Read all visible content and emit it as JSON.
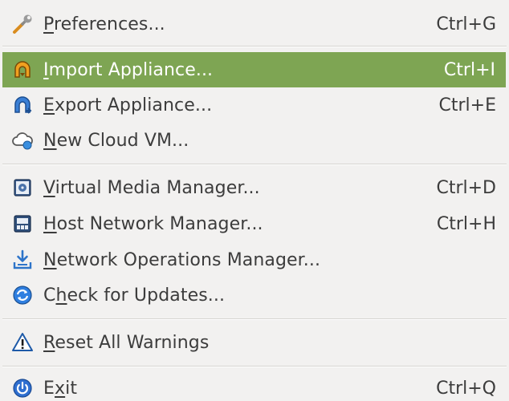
{
  "menu": {
    "items": [
      {
        "mnemonic": "P",
        "rest": "references...",
        "shortcut": "Ctrl+G",
        "icon": "wrench-icon"
      },
      {
        "mnemonic": "I",
        "rest": "mport Appliance...",
        "shortcut": "Ctrl+I",
        "icon": "import-appliance-icon",
        "highlighted": true
      },
      {
        "mnemonic": "E",
        "rest": "xport Appliance...",
        "shortcut": "Ctrl+E",
        "icon": "export-appliance-icon"
      },
      {
        "mnemonic": "N",
        "rest": "ew Cloud VM...",
        "shortcut": "",
        "icon": "cloud-icon"
      },
      {
        "mnemonic": "V",
        "rest": "irtual Media Manager...",
        "shortcut": "Ctrl+D",
        "icon": "media-manager-icon"
      },
      {
        "mnemonic": "H",
        "rest": "ost Network Manager...",
        "shortcut": "Ctrl+H",
        "icon": "network-manager-icon"
      },
      {
        "mnemonic": "N",
        "rest": "etwork Operations Manager...",
        "shortcut": "",
        "icon": "download-tray-icon"
      },
      {
        "pre": "C",
        "mnemonic": "h",
        "rest": "eck for Updates...",
        "shortcut": "",
        "icon": "refresh-icon"
      },
      {
        "mnemonic": "R",
        "rest": "eset All Warnings",
        "shortcut": "",
        "icon": "warning-icon"
      },
      {
        "mnemonic": "x",
        "pre": "E",
        "rest": "it",
        "shortcut": "Ctrl+Q",
        "icon": "power-icon"
      }
    ]
  },
  "colors": {
    "highlight": "#7ea553",
    "text": "#3c3c3c",
    "background": "#f2f1f0"
  }
}
